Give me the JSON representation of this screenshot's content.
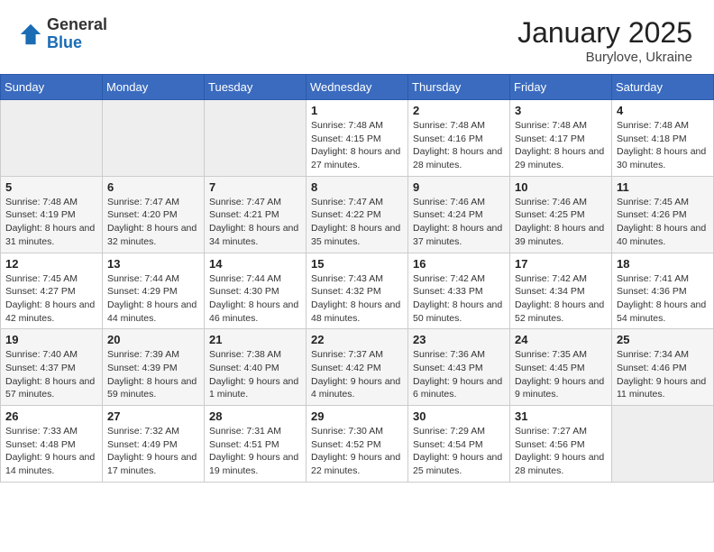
{
  "header": {
    "logo": {
      "general": "General",
      "blue": "Blue"
    },
    "title": "January 2025",
    "location": "Burylove, Ukraine"
  },
  "weekdays": [
    "Sunday",
    "Monday",
    "Tuesday",
    "Wednesday",
    "Thursday",
    "Friday",
    "Saturday"
  ],
  "weeks": [
    [
      {
        "day": "",
        "info": ""
      },
      {
        "day": "",
        "info": ""
      },
      {
        "day": "",
        "info": ""
      },
      {
        "day": "1",
        "info": "Sunrise: 7:48 AM\nSunset: 4:15 PM\nDaylight: 8 hours and 27 minutes."
      },
      {
        "day": "2",
        "info": "Sunrise: 7:48 AM\nSunset: 4:16 PM\nDaylight: 8 hours and 28 minutes."
      },
      {
        "day": "3",
        "info": "Sunrise: 7:48 AM\nSunset: 4:17 PM\nDaylight: 8 hours and 29 minutes."
      },
      {
        "day": "4",
        "info": "Sunrise: 7:48 AM\nSunset: 4:18 PM\nDaylight: 8 hours and 30 minutes."
      }
    ],
    [
      {
        "day": "5",
        "info": "Sunrise: 7:48 AM\nSunset: 4:19 PM\nDaylight: 8 hours and 31 minutes."
      },
      {
        "day": "6",
        "info": "Sunrise: 7:47 AM\nSunset: 4:20 PM\nDaylight: 8 hours and 32 minutes."
      },
      {
        "day": "7",
        "info": "Sunrise: 7:47 AM\nSunset: 4:21 PM\nDaylight: 8 hours and 34 minutes."
      },
      {
        "day": "8",
        "info": "Sunrise: 7:47 AM\nSunset: 4:22 PM\nDaylight: 8 hours and 35 minutes."
      },
      {
        "day": "9",
        "info": "Sunrise: 7:46 AM\nSunset: 4:24 PM\nDaylight: 8 hours and 37 minutes."
      },
      {
        "day": "10",
        "info": "Sunrise: 7:46 AM\nSunset: 4:25 PM\nDaylight: 8 hours and 39 minutes."
      },
      {
        "day": "11",
        "info": "Sunrise: 7:45 AM\nSunset: 4:26 PM\nDaylight: 8 hours and 40 minutes."
      }
    ],
    [
      {
        "day": "12",
        "info": "Sunrise: 7:45 AM\nSunset: 4:27 PM\nDaylight: 8 hours and 42 minutes."
      },
      {
        "day": "13",
        "info": "Sunrise: 7:44 AM\nSunset: 4:29 PM\nDaylight: 8 hours and 44 minutes."
      },
      {
        "day": "14",
        "info": "Sunrise: 7:44 AM\nSunset: 4:30 PM\nDaylight: 8 hours and 46 minutes."
      },
      {
        "day": "15",
        "info": "Sunrise: 7:43 AM\nSunset: 4:32 PM\nDaylight: 8 hours and 48 minutes."
      },
      {
        "day": "16",
        "info": "Sunrise: 7:42 AM\nSunset: 4:33 PM\nDaylight: 8 hours and 50 minutes."
      },
      {
        "day": "17",
        "info": "Sunrise: 7:42 AM\nSunset: 4:34 PM\nDaylight: 8 hours and 52 minutes."
      },
      {
        "day": "18",
        "info": "Sunrise: 7:41 AM\nSunset: 4:36 PM\nDaylight: 8 hours and 54 minutes."
      }
    ],
    [
      {
        "day": "19",
        "info": "Sunrise: 7:40 AM\nSunset: 4:37 PM\nDaylight: 8 hours and 57 minutes."
      },
      {
        "day": "20",
        "info": "Sunrise: 7:39 AM\nSunset: 4:39 PM\nDaylight: 8 hours and 59 minutes."
      },
      {
        "day": "21",
        "info": "Sunrise: 7:38 AM\nSunset: 4:40 PM\nDaylight: 9 hours and 1 minute."
      },
      {
        "day": "22",
        "info": "Sunrise: 7:37 AM\nSunset: 4:42 PM\nDaylight: 9 hours and 4 minutes."
      },
      {
        "day": "23",
        "info": "Sunrise: 7:36 AM\nSunset: 4:43 PM\nDaylight: 9 hours and 6 minutes."
      },
      {
        "day": "24",
        "info": "Sunrise: 7:35 AM\nSunset: 4:45 PM\nDaylight: 9 hours and 9 minutes."
      },
      {
        "day": "25",
        "info": "Sunrise: 7:34 AM\nSunset: 4:46 PM\nDaylight: 9 hours and 11 minutes."
      }
    ],
    [
      {
        "day": "26",
        "info": "Sunrise: 7:33 AM\nSunset: 4:48 PM\nDaylight: 9 hours and 14 minutes."
      },
      {
        "day": "27",
        "info": "Sunrise: 7:32 AM\nSunset: 4:49 PM\nDaylight: 9 hours and 17 minutes."
      },
      {
        "day": "28",
        "info": "Sunrise: 7:31 AM\nSunset: 4:51 PM\nDaylight: 9 hours and 19 minutes."
      },
      {
        "day": "29",
        "info": "Sunrise: 7:30 AM\nSunset: 4:52 PM\nDaylight: 9 hours and 22 minutes."
      },
      {
        "day": "30",
        "info": "Sunrise: 7:29 AM\nSunset: 4:54 PM\nDaylight: 9 hours and 25 minutes."
      },
      {
        "day": "31",
        "info": "Sunrise: 7:27 AM\nSunset: 4:56 PM\nDaylight: 9 hours and 28 minutes."
      },
      {
        "day": "",
        "info": ""
      }
    ]
  ]
}
